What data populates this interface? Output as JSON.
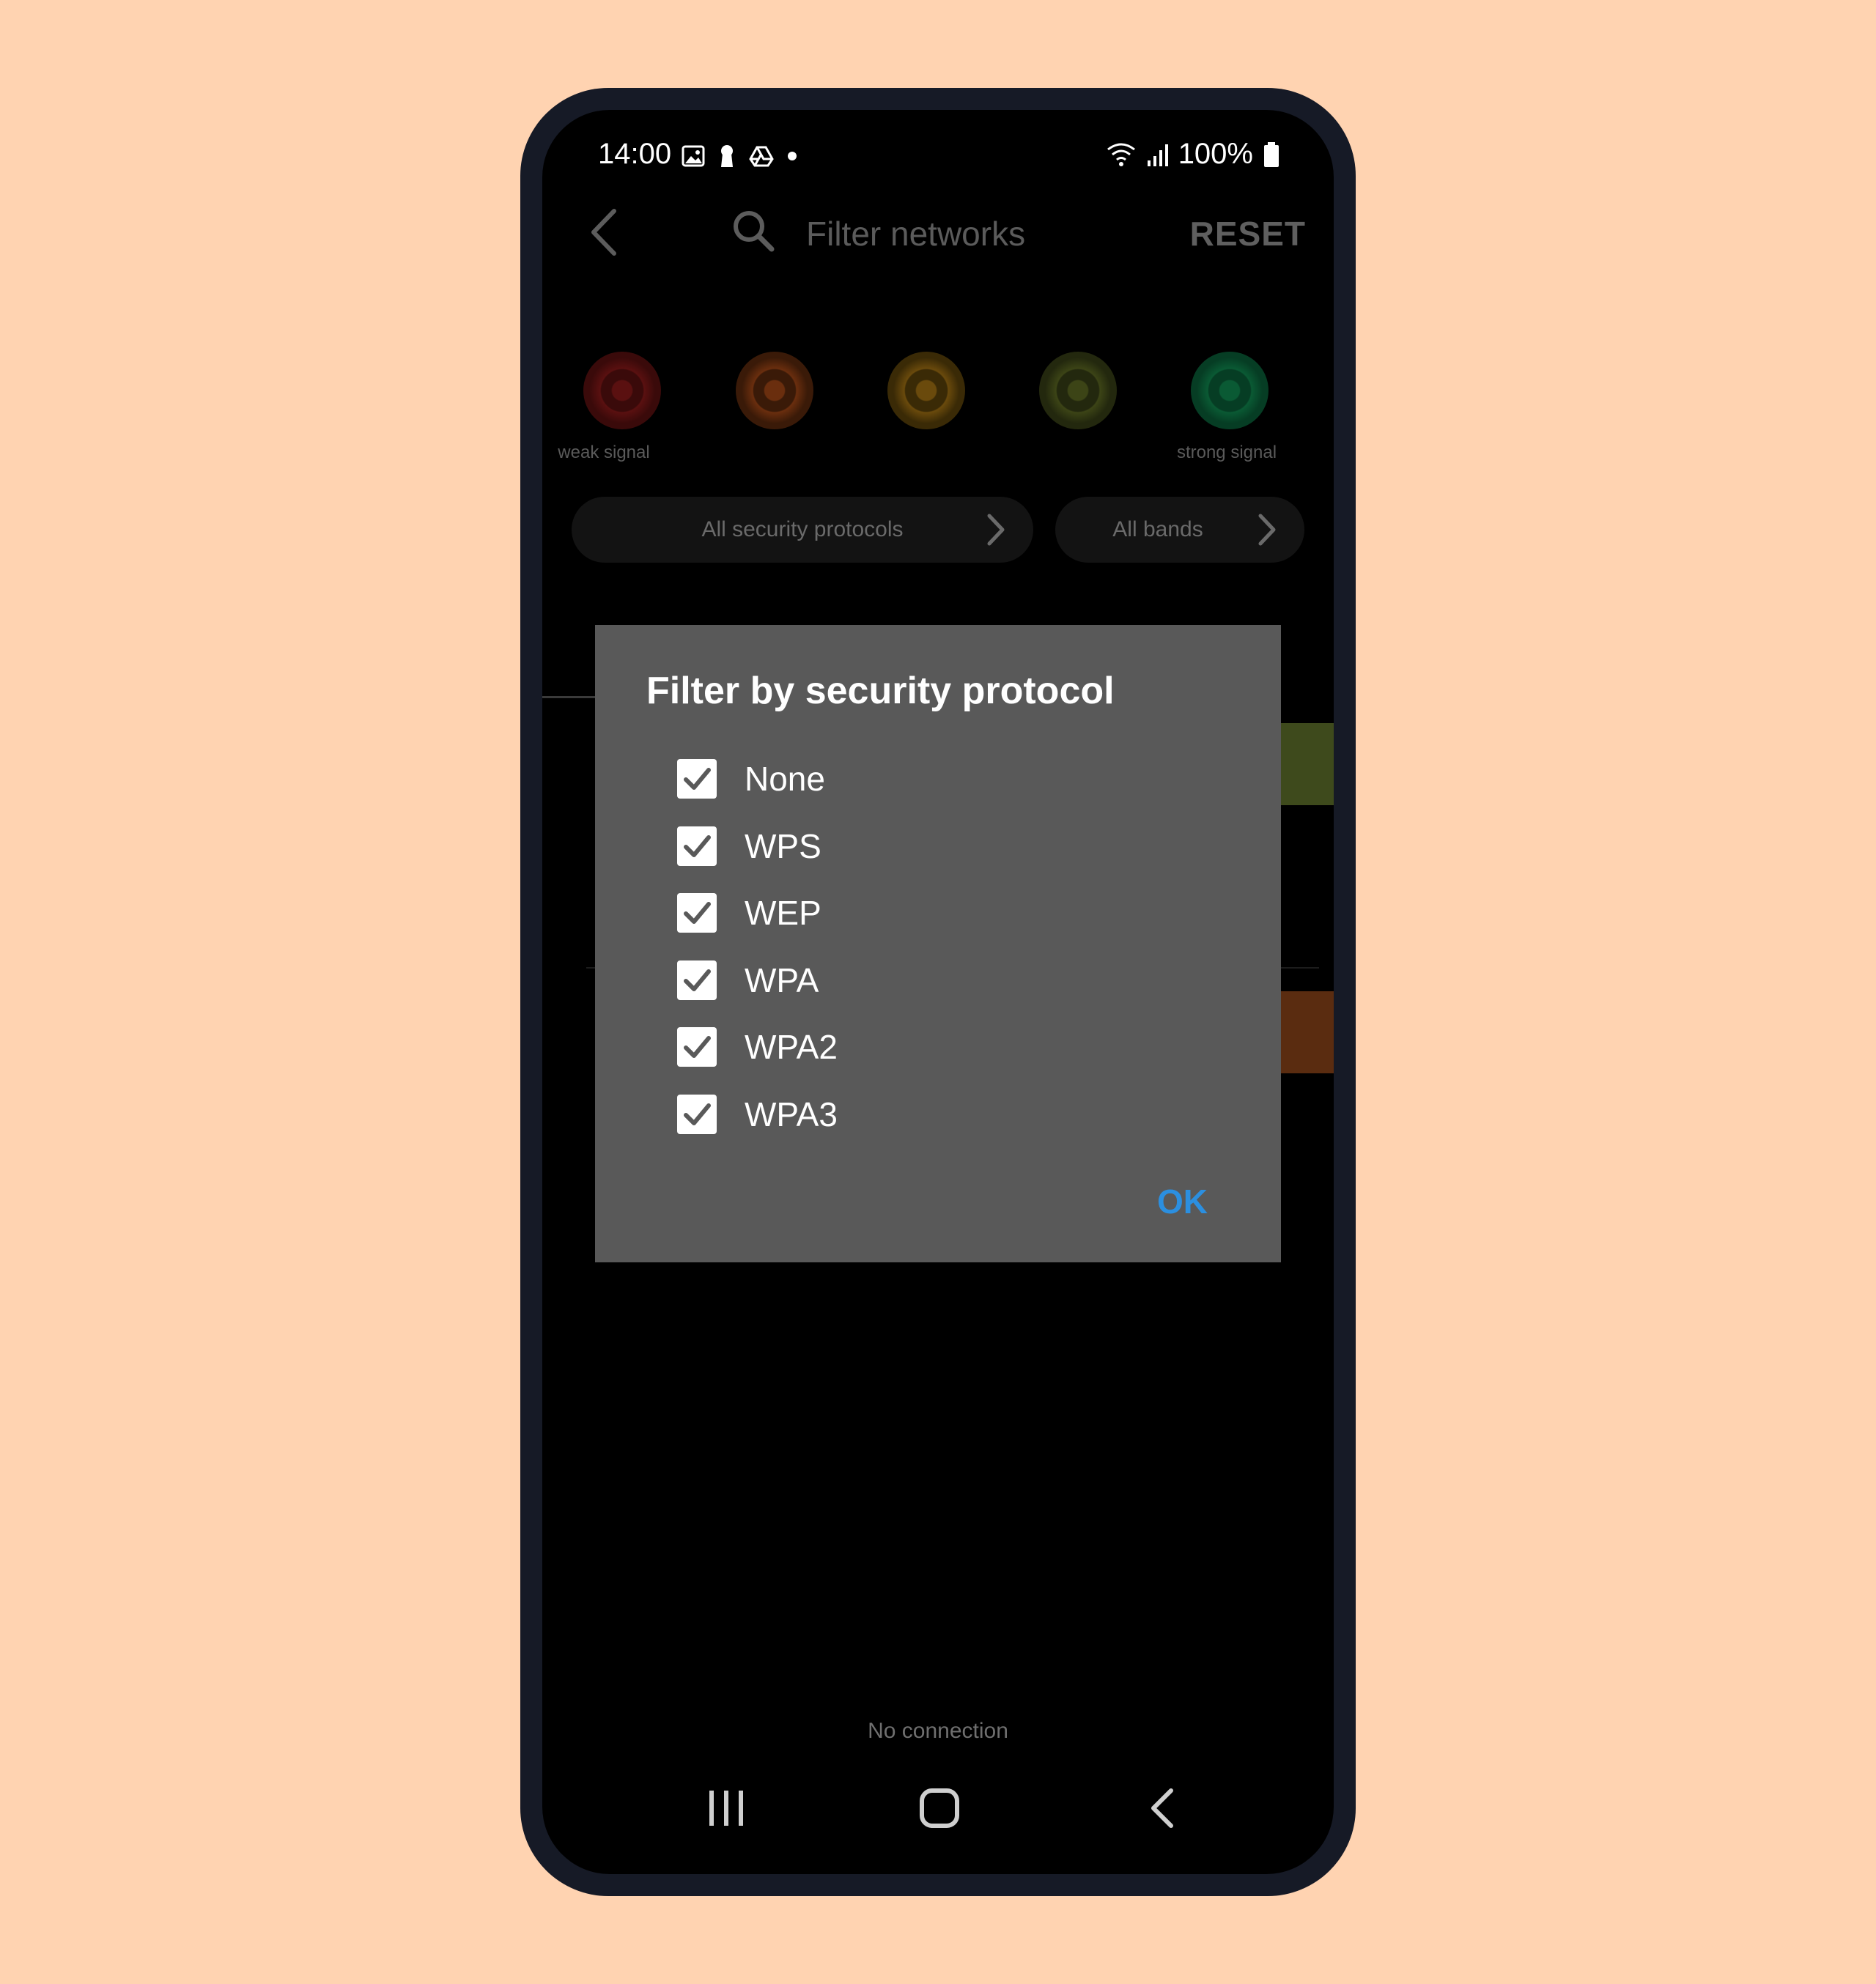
{
  "status_bar": {
    "time": "14:00",
    "battery": "100%"
  },
  "toolbar": {
    "search_placeholder": "Filter networks",
    "reset_label": "RESET"
  },
  "signal_filter": {
    "weak_label": "weak signal",
    "strong_label": "strong signal",
    "levels": [
      {
        "name": "level-1",
        "color": "#3a0a0a",
        "dot": "#5a1010"
      },
      {
        "name": "level-2",
        "color": "#3a1a08",
        "dot": "#6a2e0e"
      },
      {
        "name": "level-3",
        "color": "#3a2a06",
        "dot": "#6a4a0c"
      },
      {
        "name": "level-4",
        "color": "#23280e",
        "dot": "#3c4416"
      },
      {
        "name": "level-5",
        "color": "#063d24",
        "dot": "#0a5a34"
      }
    ]
  },
  "filters": {
    "security_label": "All security protocols",
    "bands_label": "All bands"
  },
  "dialog": {
    "title": "Filter by security protocol",
    "options": [
      {
        "label": "None",
        "checked": true
      },
      {
        "label": "WPS",
        "checked": true
      },
      {
        "label": "WEP",
        "checked": true
      },
      {
        "label": "WPA",
        "checked": true
      },
      {
        "label": "WPA2",
        "checked": true
      },
      {
        "label": "WPA3",
        "checked": true
      }
    ],
    "ok_label": "OK"
  },
  "footer": {
    "status": "No connection"
  },
  "colors": {
    "accent": "#2b8fe0",
    "dialog_bg": "#595959",
    "background": "#ffd3b1"
  }
}
